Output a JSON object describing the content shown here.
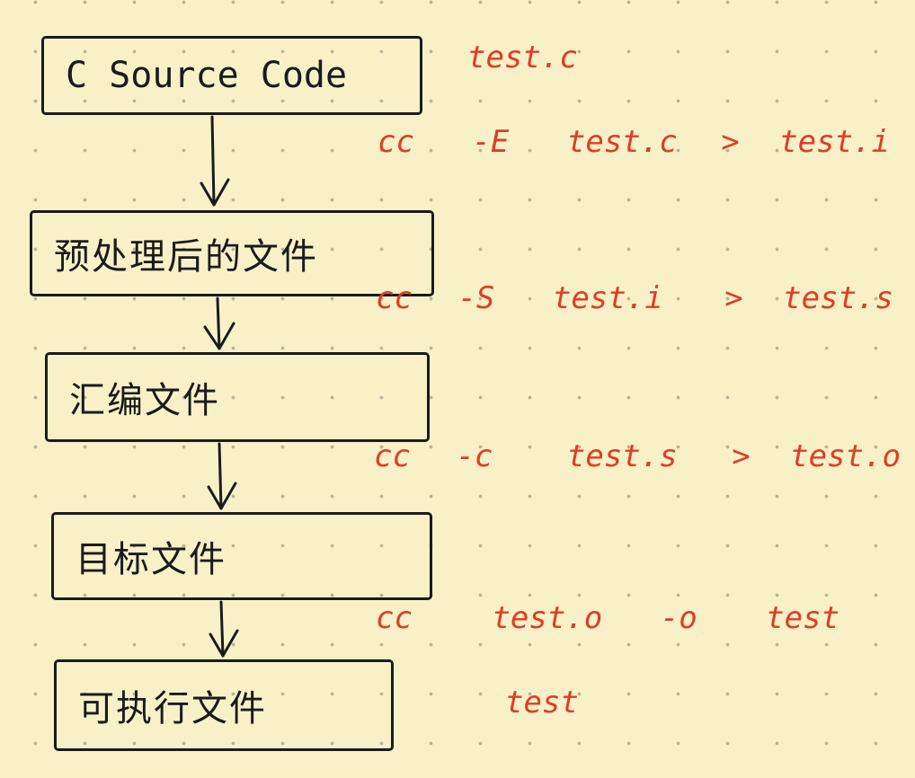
{
  "boxes": [
    {
      "id": "source",
      "label": "C Source Code"
    },
    {
      "id": "preprocessed",
      "label": "预处理后的文件"
    },
    {
      "id": "assembly",
      "label": "汇编文件"
    },
    {
      "id": "object",
      "label": "目标文件"
    },
    {
      "id": "executable",
      "label": "可执行文件"
    }
  ],
  "annotations": {
    "source_file": "test.c",
    "step1": {
      "cmd": "cc",
      "flag": "-E",
      "input": "test.c",
      "op": ">",
      "output": "test.i"
    },
    "step2": {
      "cmd": "cc",
      "flag": "-S",
      "input": "test.i",
      "op": ">",
      "output": "test.s"
    },
    "step3": {
      "cmd": "cc",
      "flag": "-c",
      "input": "test.s",
      "op": ">",
      "output": "test.o"
    },
    "step4": {
      "cmd": "cc",
      "input": "test.o",
      "flag": "-o",
      "output": "test"
    },
    "result_file": "test"
  },
  "colors": {
    "ink": "#1b1b1b",
    "annotation": "#e23b26",
    "paper": "#f8f1c8"
  }
}
